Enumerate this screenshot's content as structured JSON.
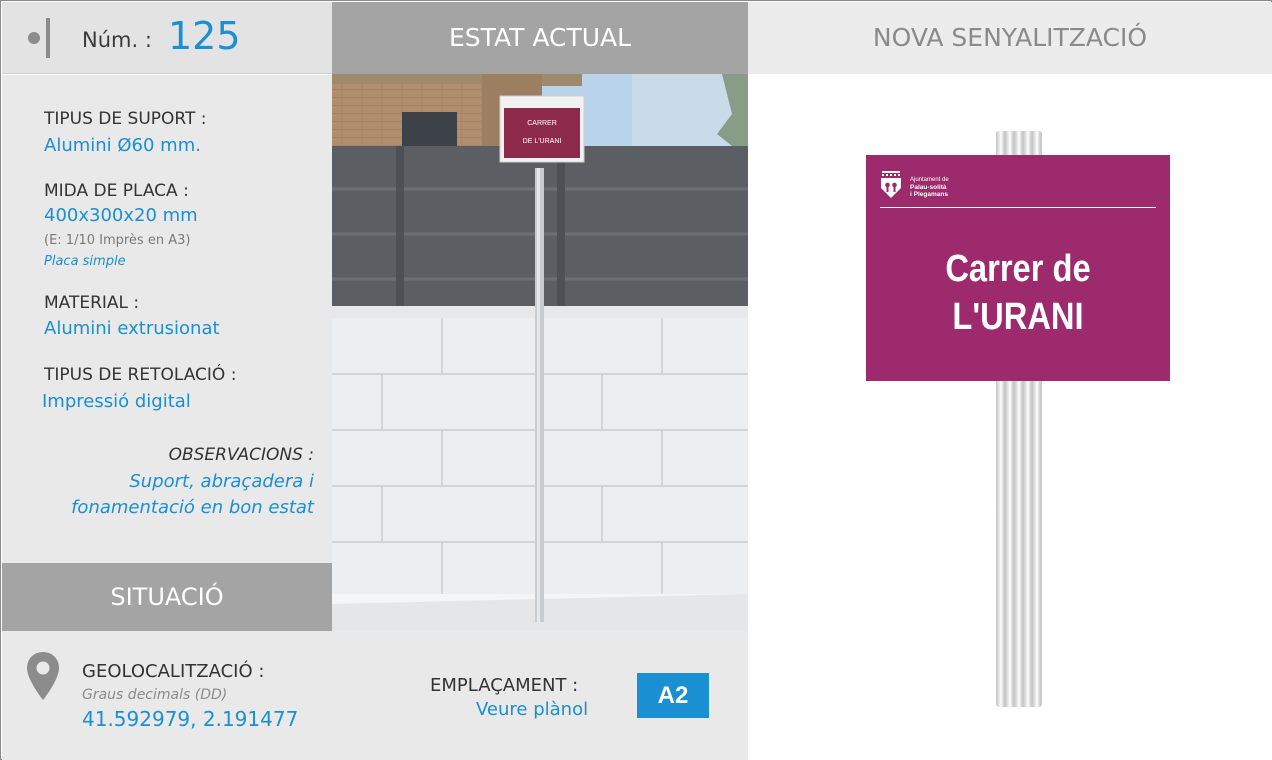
{
  "header": {
    "num_label": "Núm. :",
    "num_value": "125",
    "current_state": "ESTAT ACTUAL",
    "new_signage": "NOVA SENYALITZACIÓ"
  },
  "specs": {
    "support_label": "TIPUS DE SUPORT :",
    "support_value": "Alumini Ø60 mm.",
    "plate_size_label": "MIDA DE PLACA :",
    "plate_size_value": "400x300x20 mm",
    "plate_scale_note": "(E: 1/10 Imprès en A3)",
    "plate_type": "Placa simple",
    "material_label": "MATERIAL :",
    "material_value": "Alumini extrusionat",
    "lettering_label": "TIPUS DE RETOLACIÓ :",
    "lettering_value": "Impressió digital",
    "observations_label": "OBSERVACIONS :",
    "observations_line1": "Suport, abraçadera i",
    "observations_line2": "fonamentació en bon estat"
  },
  "situation": {
    "title": "SITUACIÓ",
    "geo_label": "GEOLOCALITZACIÓ :",
    "geo_note": "Graus decimals (DD)",
    "geo_value": "41.592979, 2.191477",
    "location_label": "EMPLAÇAMENT :",
    "location_link": "Veure plànol",
    "location_code": "A2"
  },
  "photo_sign": {
    "line1": "CARRER",
    "line2": "DE L'URANI"
  },
  "new_sign": {
    "org_line1": "Ajuntament de",
    "org_line2": "Palau-solità",
    "org_line3": "i Plegamans",
    "text_line1": "Carrer de",
    "text_line2": "L'URANI",
    "color": "#9c2a6d"
  },
  "colors": {
    "accent_blue": "#1a8fd1",
    "header_gray": "#a4a4a4",
    "panel_gray": "#e9e9e9"
  },
  "icons": {
    "location": "map-pin-icon"
  }
}
